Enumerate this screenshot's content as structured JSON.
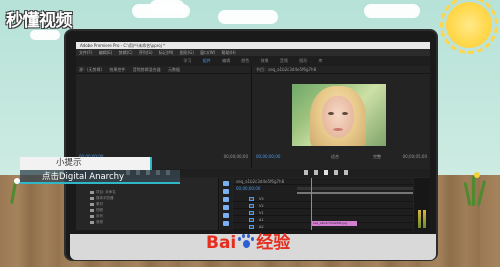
{
  "logo": {
    "text": "秒懂视频"
  },
  "app": {
    "title": "Adobe Premiere Pro - C:\\用户\\未命名\\pproj *",
    "menus": [
      "文件(F)",
      "编辑(E)",
      "剪辑(C)",
      "序列(S)",
      "标记(M)",
      "图形(G)",
      "窗口(W)",
      "帮助(H)"
    ],
    "workspaces": [
      "学习",
      "组件",
      "编辑",
      "颜色",
      "效果",
      "音频",
      "图形",
      "库"
    ],
    "active_workspace": "组件"
  },
  "source_panel": {
    "tabs": [
      "源：(无剪辑)",
      "效果控件",
      "音频剪辑混合器",
      "元数据"
    ],
    "timecode_left": "00;00;00;00",
    "timecode_right": "00;00;00;00"
  },
  "program_panel": {
    "tabs": [
      "节目：seq_a1b2c3d4e5f6g7h8"
    ],
    "timecode_left": "00;00;00;00",
    "fit_label": "适合",
    "quality_label": "完整",
    "timecode_right": "00;00;05;00"
  },
  "project_panel": {
    "rows": [
      "项目: 未命名",
      "媒体浏览器",
      "素材",
      "视频",
      "序列",
      "音频"
    ]
  },
  "timeline_panel": {
    "tab": "seq_a1b2c3d4e5f6g7h8",
    "timecode": "00;00;00;00",
    "tracks": [
      "V3",
      "V2",
      "V1",
      "A1",
      "A2",
      "A3"
    ],
    "clip_label": "seq_a1b2c3d4e5f6.jpg"
  },
  "tip": {
    "title": "小提示",
    "text": "点击Digital Anarchy"
  },
  "watermark": {
    "prefix": "Bai",
    "suffix": "经验"
  },
  "colors": {
    "accent_blue": "#4b9cf0",
    "clip_pink": "#d27fd1",
    "tip_cyan": "#2fb6c8",
    "baidu_red": "#e62e1f",
    "baidu_blue": "#2c5fd4"
  }
}
